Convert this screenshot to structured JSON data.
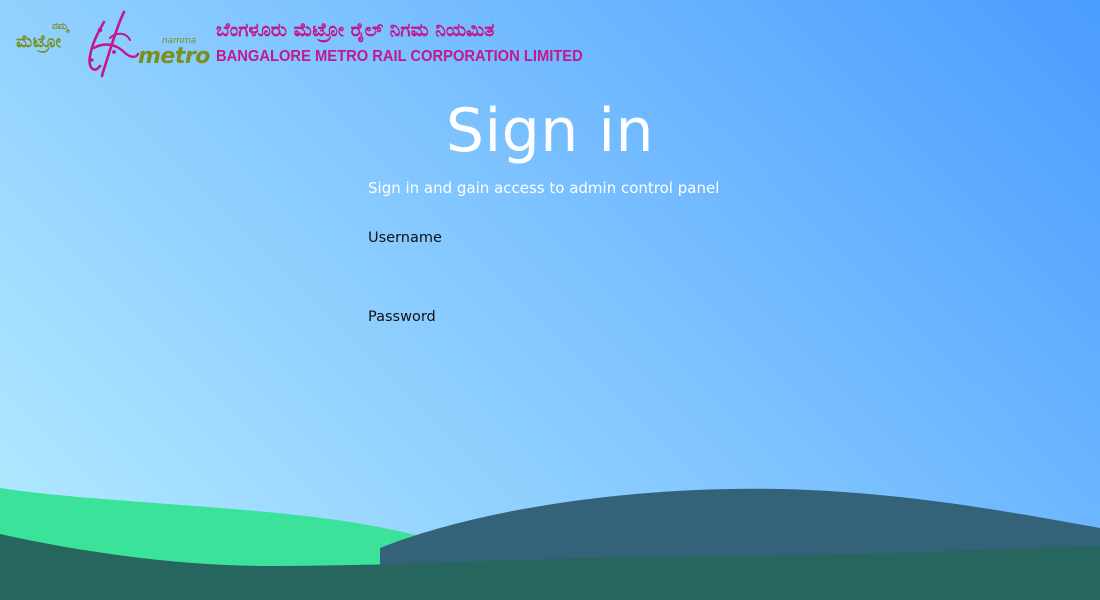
{
  "header": {
    "logo": {
      "kannada_small": "ನಮ್ಮ",
      "kannada_big": "ಮೆಟ್ರೋ",
      "namma": "namma",
      "metro": "metro"
    },
    "org_name_kannada": "ಬೆಂಗಳೂರು ಮೆಟ್ರೋ ರೈಲ್ ನಿಗಮ ನಿಯಮಿತ",
    "org_name_english": "BANGALORE METRO RAIL CORPORATION LIMITED"
  },
  "signin": {
    "title": "Sign in",
    "subtitle": "Sign in and gain access to admin control panel",
    "username_label": "Username",
    "username_value": "",
    "password_label": "Password",
    "password_value": ""
  },
  "colors": {
    "brand_magenta": "#c2188e",
    "brand_olive": "#7a8f1c",
    "wave_green": "#3ae29a",
    "wave_slate": "#346279",
    "wave_dark": "#27655f"
  }
}
